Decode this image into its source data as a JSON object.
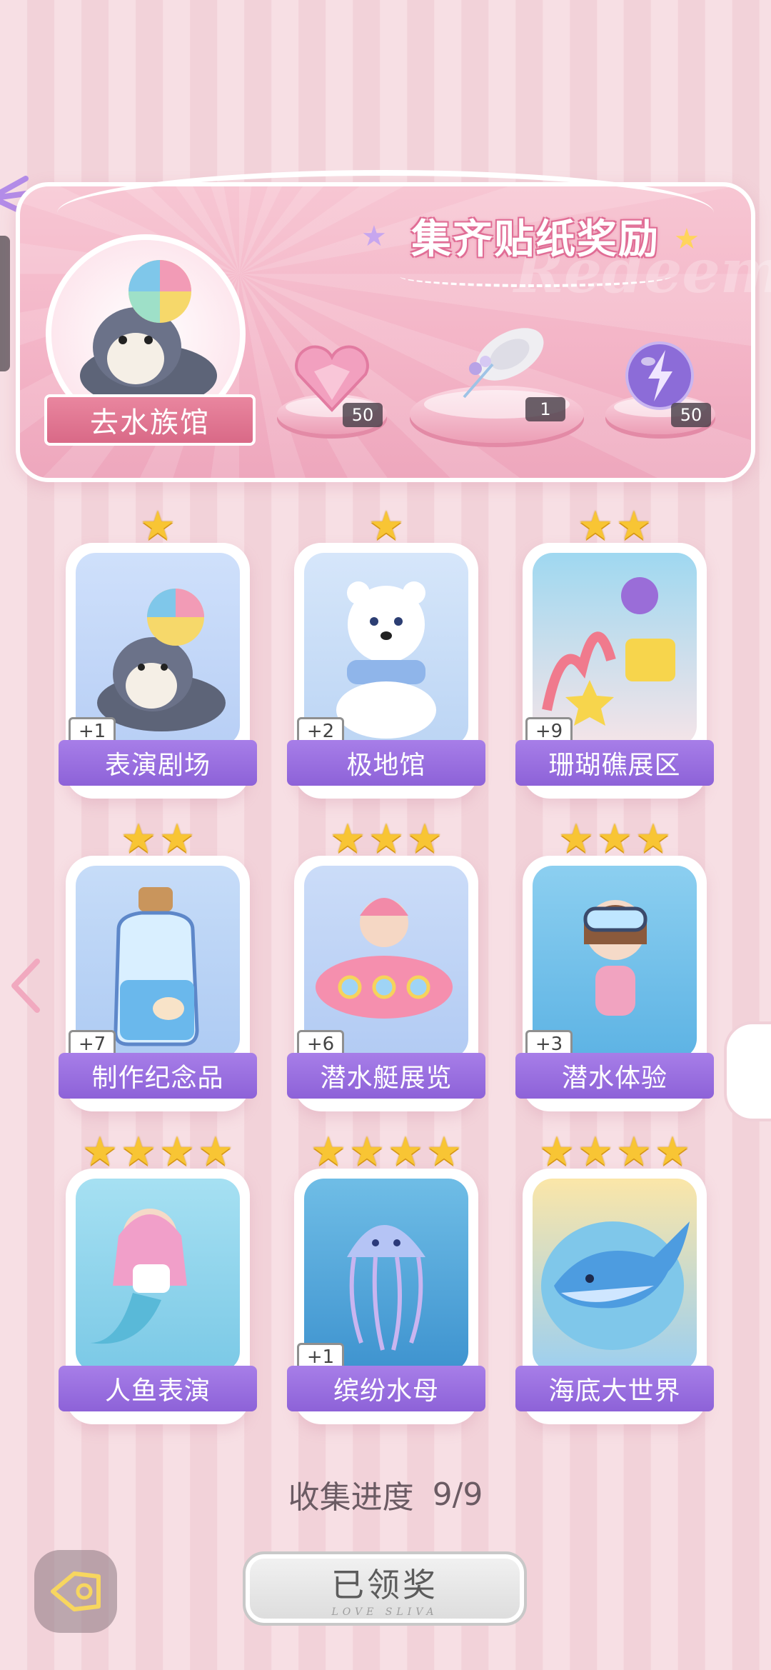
{
  "banner": {
    "title": "集齐贴纸奖励",
    "watermark": "Redeem",
    "location_button": "去水族馆",
    "rewards": [
      {
        "icon": "pink-heart-gem-icon",
        "count": "50"
      },
      {
        "icon": "flower-sun-hat-icon",
        "count": "1"
      },
      {
        "icon": "lightning-orb-icon",
        "count": "50"
      }
    ]
  },
  "cards": [
    {
      "label": "表演剧场",
      "plus": "+1",
      "stars": 1,
      "art": "seal-with-ball"
    },
    {
      "label": "极地馆",
      "plus": "+2",
      "stars": 1,
      "art": "polar-bear-with-scarf"
    },
    {
      "label": "珊瑚礁展区",
      "plus": "+9",
      "stars": 2,
      "art": "coral-reef-starfish"
    },
    {
      "label": "制作纪念品",
      "plus": "+7",
      "stars": 2,
      "art": "message-bottle"
    },
    {
      "label": "潜水艇展览",
      "plus": "+6",
      "stars": 3,
      "art": "submarine-girl"
    },
    {
      "label": "潜水体验",
      "plus": "+3",
      "stars": 3,
      "art": "snorkel-girl"
    },
    {
      "label": "人鱼表演",
      "plus": "",
      "stars": 4,
      "art": "mermaid"
    },
    {
      "label": "缤纷水母",
      "plus": "+1",
      "stars": 4,
      "art": "jellyfish"
    },
    {
      "label": "海底大世界",
      "plus": "",
      "stars": 4,
      "art": "whale"
    }
  ],
  "progress": {
    "label": "收集进度",
    "value": "9/9"
  },
  "claim_button": {
    "label": "已领奖",
    "sub": "LOVE SLIVA"
  },
  "colors": {
    "label_purple": "#9a6fe0",
    "star_gold": "#f8c534",
    "banner_pink": "#f3b3c6"
  }
}
